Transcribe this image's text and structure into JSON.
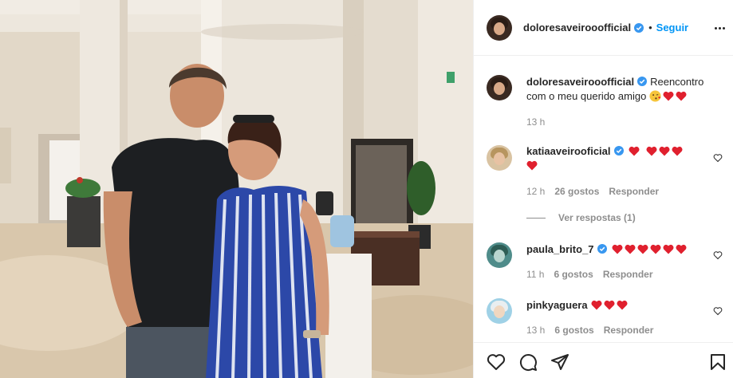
{
  "header": {
    "username": "doloresaveirooofficial",
    "separator": "•",
    "follow_label": "Seguir"
  },
  "caption": {
    "username": "doloresaveirooofficial",
    "text": "Reencontro com o meu querido amigo",
    "time": "13 h"
  },
  "comments": [
    {
      "username": "katiaaveirooficial",
      "time": "12 h",
      "likes": "26 gostos",
      "reply_label": "Responder"
    },
    {
      "username": "paula_brito_7",
      "time": "11 h",
      "likes": "6 gostos",
      "reply_label": "Responder"
    },
    {
      "username": "pinkyaguera",
      "time": "13 h",
      "likes": "6 gostos",
      "reply_label": "Responder"
    }
  ],
  "view_replies": "Ver respostas (1)",
  "icons": {
    "like": "heart-icon",
    "comment": "comment-icon",
    "share": "paper-plane-icon",
    "save": "bookmark-icon",
    "verified": "verified-badge-icon",
    "options": "more-options-icon"
  },
  "colors": {
    "link": "#0095f6",
    "verified": "#3897f0",
    "muted": "#8e8e8e",
    "heart_emoji": "#e0202e"
  }
}
